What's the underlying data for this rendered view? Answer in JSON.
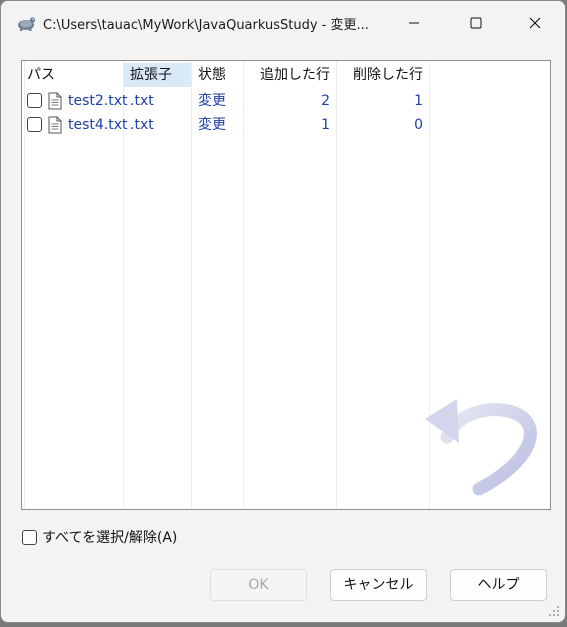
{
  "window": {
    "title": "C:\\Users\\tauac\\MyWork\\JavaQuarkusStudy - 変更..."
  },
  "icons": {
    "app": "tortoise-icon",
    "minimize": "minimize-icon",
    "maximize": "maximize-icon",
    "close": "close-icon",
    "file": "text-file-icon",
    "watermark": "revert-arrow-icon",
    "grip": "resize-grip-icon"
  },
  "columns": {
    "path": "パス",
    "extension": "拡張子",
    "status": "状態",
    "lines_added": "追加した行",
    "lines_removed": "削除した行"
  },
  "files": [
    {
      "name": "test2.txt",
      "extension": ".txt",
      "status": "変更",
      "lines_added": "2",
      "lines_removed": "1",
      "checked": false
    },
    {
      "name": "test4.txt",
      "extension": ".txt",
      "status": "変更",
      "lines_added": "1",
      "lines_removed": "0",
      "checked": false
    }
  ],
  "select_all": {
    "label": "すべてを選択/解除(A)",
    "checked": false
  },
  "buttons": {
    "ok": "OK",
    "cancel": "キャンセル",
    "help": "ヘルプ"
  },
  "colors": {
    "link_text": "#1f3fa6",
    "selected_column_header": "#d9e9f7",
    "disabled_text": "#a8a8a8"
  }
}
